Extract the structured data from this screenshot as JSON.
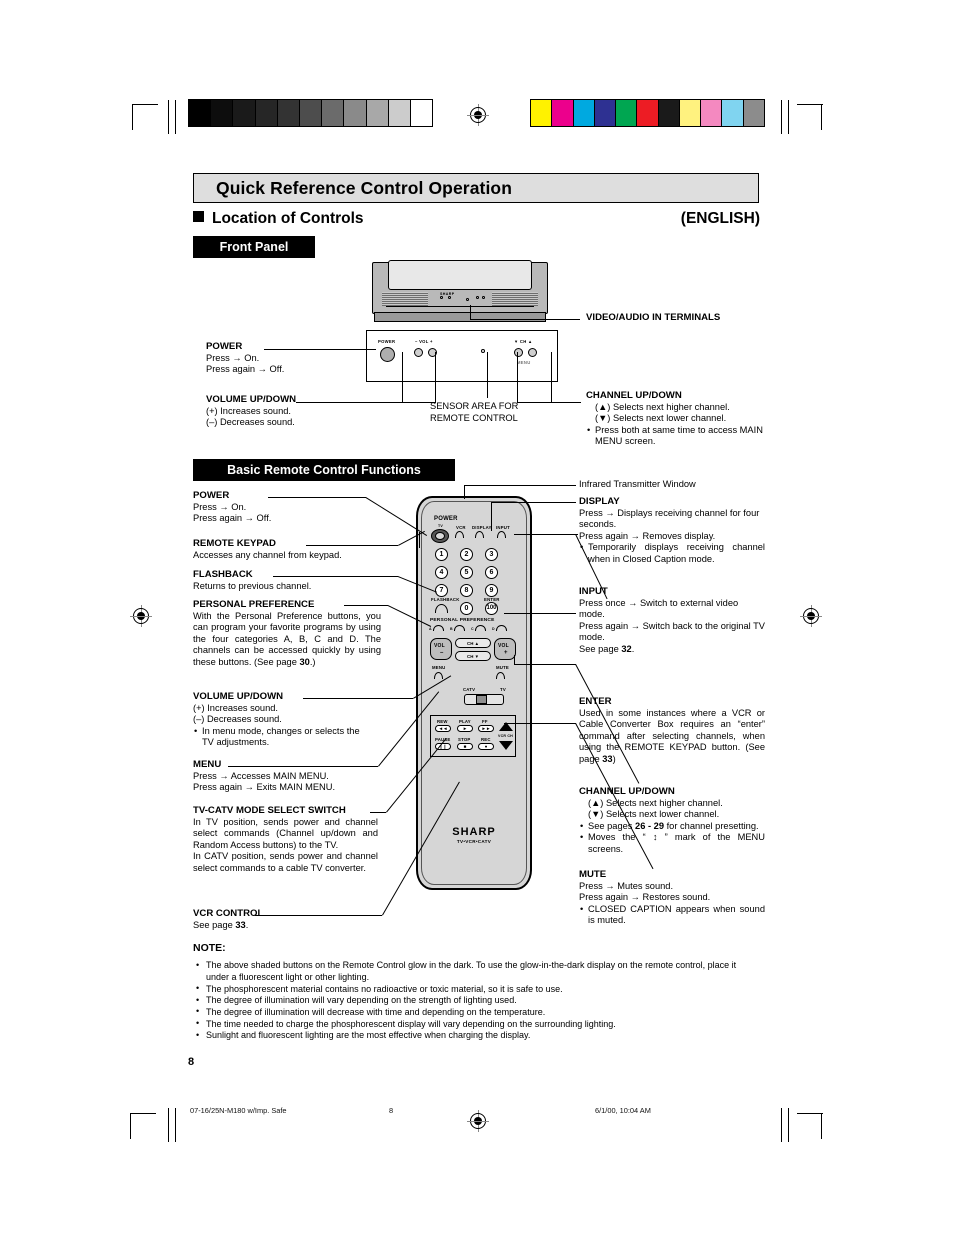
{
  "header": {
    "title": "Quick Reference Control Operation",
    "section": "Location of Controls",
    "language": "(ENGLISH)"
  },
  "front_panel": {
    "band_label": "Front Panel",
    "tv_logo": "SHARP",
    "panel_labels": {
      "power": "POWER",
      "volume": "– VOL +",
      "channel": "▼ CH ▲",
      "menu": "MENU"
    },
    "callouts": {
      "power": {
        "title": "POWER",
        "lines": [
          "Press → On.",
          "Press again → Off."
        ]
      },
      "volume": {
        "title": "VOLUME UP/DOWN",
        "lines": [
          "(+) Increases sound.",
          "(–) Decreases sound."
        ]
      },
      "sensor": {
        "line1": "SENSOR AREA FOR",
        "line2": "REMOTE CONTROL"
      },
      "video_audio": {
        "title": "VIDEO/AUDIO IN TERMINALS"
      },
      "channel": {
        "title": "CHANNEL UP/DOWN",
        "lines": [
          "(▲) Selects next higher channel.",
          "(▼) Selects next lower channel."
        ],
        "bullets": [
          "Press both at same time to access MAIN MENU screen."
        ]
      }
    }
  },
  "remote_section": {
    "band_label": "Basic Remote Control Functions",
    "left_callouts": [
      {
        "title": "POWER",
        "lines": [
          "Press → On.",
          "Press again → Off."
        ]
      },
      {
        "title": "REMOTE KEYPAD",
        "lines": [
          "Accesses any channel from keypad."
        ]
      },
      {
        "title": "FLASHBACK",
        "lines": [
          "Returns to previous channel."
        ]
      },
      {
        "title": "PERSONAL PREFERENCE",
        "lines": [
          "With the Personal Preference buttons, you can program your favorite programs by using the four categories A, B, C and D. The channels can be accessed quickly by using these buttons. (See page 30.)"
        ],
        "bold_refs": [
          "30"
        ]
      },
      {
        "title": "VOLUME UP/DOWN",
        "lines": [
          "(+) Increases sound.",
          "(–) Decreases sound."
        ],
        "bullets": [
          "In menu mode, changes or selects the TV adjustments."
        ]
      },
      {
        "title": "MENU",
        "lines": [
          "Press → Accesses MAIN MENU.",
          "Press again → Exits MAIN MENU."
        ]
      },
      {
        "title": "TV-CATV MODE SELECT SWITCH",
        "lines": [
          "In TV position, sends power and channel select commands (Channel up/down and Random Access buttons) to the TV.",
          "In CATV position, sends power and channel select commands to a cable TV converter."
        ]
      },
      {
        "title": "VCR CONTROL",
        "lines": [
          "See page 33."
        ],
        "bold_refs": [
          "33"
        ]
      }
    ],
    "right_callouts": [
      {
        "title": "Infrared Transmitter Window",
        "plain_title": true,
        "lines": []
      },
      {
        "title": "DISPLAY",
        "lines": [
          "Press → Displays receiving channel for four seconds.",
          "Press again → Removes display."
        ],
        "bullets": [
          "Temporarily displays receiving channel when in Closed Caption mode."
        ]
      },
      {
        "title": "INPUT",
        "lines": [
          "Press once → Switch to external video mode.",
          "Press again → Switch back to the original TV mode.",
          "See page 32."
        ],
        "bold_refs": [
          "32"
        ]
      },
      {
        "title": "ENTER",
        "lines": [
          "Used in some instances where a VCR or Cable Converter Box requires an “enter” command after selecting channels, when using the REMOTE KEYPAD button. (See page 33)"
        ],
        "bold_refs": [
          "33"
        ]
      },
      {
        "title": "CHANNEL UP/DOWN",
        "lines": [
          "(▲) Selects next higher channel.",
          "(▼) Selects next lower channel."
        ],
        "bullets": [
          "See pages 26 - 29 for channel presetting.",
          "Moves the “ ↕ ” mark of the MENU screens."
        ]
      },
      {
        "title": "MUTE",
        "lines": [
          "Press → Mutes sound.",
          "Press again → Restores sound."
        ],
        "bullets": [
          "CLOSED CAPTION appears when sound is muted."
        ]
      }
    ],
    "remote_art": {
      "power": "POWER",
      "tv": "TV",
      "vcr": "VCR",
      "display": "DISPLAY",
      "input": "INPUT",
      "keys": [
        "1",
        "2",
        "3",
        "4",
        "5",
        "6",
        "7",
        "8",
        "9",
        "0",
        "100"
      ],
      "flashback": "FLASHBACK",
      "enter": "ENTER",
      "personal_preference": "PERSONAL PREFERENCE",
      "pp_keys": [
        "A",
        "B",
        "C",
        "D"
      ],
      "vol_minus": "VOL",
      "vol_minus_sign": "–",
      "vol_plus": "VOL",
      "vol_plus_sign": "+",
      "ch_up": "CH ▲",
      "ch_down": "CH ▼",
      "menu": "MENU",
      "mute": "MUTE",
      "catv": "CATV",
      "tv_switch": "TV",
      "vcr_buttons": [
        {
          "label": "REW",
          "glyph": "◄◄"
        },
        {
          "label": "PLAY",
          "glyph": "►"
        },
        {
          "label": "FF",
          "glyph": "►►"
        },
        {
          "label": "PAUSE",
          "glyph": "❙❙"
        },
        {
          "label": "STOP",
          "glyph": "■"
        },
        {
          "label": "REC",
          "glyph": "●"
        }
      ],
      "vcr_ch": "VCR CH",
      "brand": "SHARP",
      "brand_sub": "TV•VCR•CATV"
    }
  },
  "note": {
    "heading": "NOTE:",
    "items": [
      "The above shaded buttons on the Remote Control glow in the dark. To use the glow-in-the-dark display on the remote control, place it under a fluorescent light or other lighting.",
      "The phosphorescent material contains no radioactive or toxic material, so it is safe to use.",
      "The degree of illumination will vary depending on the strength of lighting used.",
      "The degree of illumination will decrease with time and depending on the temperature.",
      "The time needed to charge the phosphorescent display will vary depending on the surrounding lighting.",
      "Sunlight and fluorescent lighting are the most effective when charging the display."
    ]
  },
  "footer": {
    "page_number": "8",
    "file_name": "07-16/25N-M180 w/Imp. Safe",
    "page_mark": "8",
    "timestamp": "6/1/00, 10:04 AM"
  },
  "print_bars": {
    "grayscale": [
      "#000000",
      "#0d0d0d",
      "#1a1a1a",
      "#262626",
      "#333333",
      "#4d4d4d",
      "#6b6b6b",
      "#8a8a8a",
      "#a8a8a8",
      "#cccccc",
      "#ffffff"
    ],
    "color": [
      "#fff200",
      "#ec008c",
      "#00a9e0",
      "#2e3192",
      "#00a651",
      "#ed1c24",
      "#1a1a1a",
      "#fff27f",
      "#f489c0",
      "#80d4f0",
      "#8c8c8c"
    ]
  }
}
